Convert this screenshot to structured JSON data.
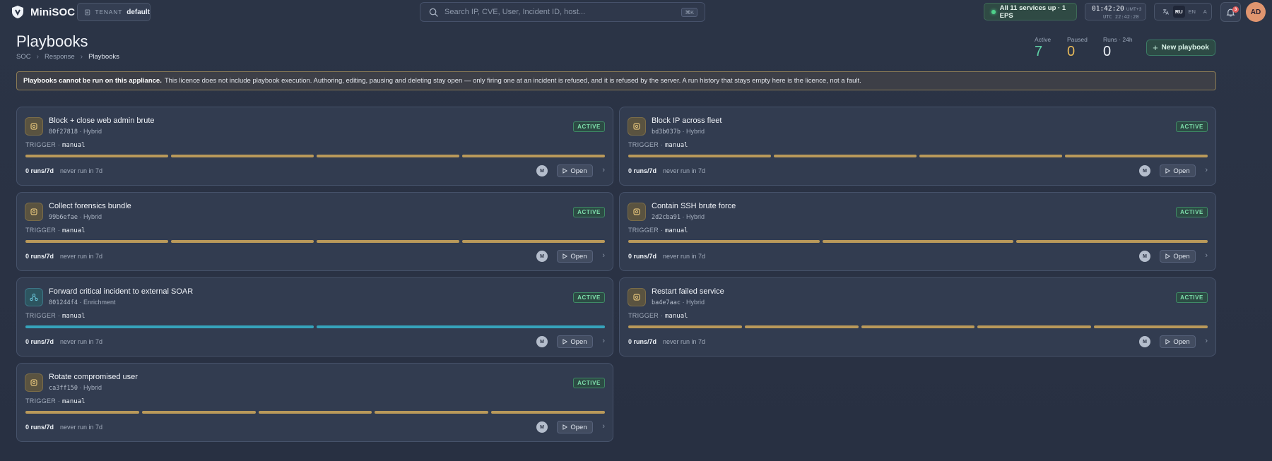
{
  "app": {
    "name": "MiniSOC",
    "tenant_label": "TENANT",
    "tenant_value": "default"
  },
  "search": {
    "placeholder": "Search IP, CVE, User, Incident ID, host...",
    "shortcut": "⌘K"
  },
  "status": {
    "services_text": "All 11 services up · 1 EPS",
    "status_color": "#4fd18b"
  },
  "clock": {
    "local_time": "01:42:20",
    "local_tz": "UMT+3",
    "utc_time": "UTC 22:42:20"
  },
  "language": {
    "options": [
      "RU",
      "EN",
      "A"
    ],
    "selected": "RU"
  },
  "notifications": {
    "count": "3"
  },
  "user": {
    "initials": "AD"
  },
  "page": {
    "title": "Playbooks",
    "breadcrumb": [
      "SOC",
      "Response",
      "Playbooks"
    ]
  },
  "stats": [
    {
      "label": "Active",
      "value": "7",
      "color": "#5fd3a8"
    },
    {
      "label": "Paused",
      "value": "0",
      "color": "#e6b95a"
    },
    {
      "label": "Runs · 24h",
      "value": "0",
      "color": "#eef2f8"
    }
  ],
  "actions": {
    "new_playbook": "New playbook"
  },
  "banner": {
    "title": "Playbooks cannot be run on this appliance.",
    "text": "This licence does not include playbook execution. Authoring, editing, pausing and deleting stay open — only firing one at an incident is refused, and it is refused by the server. A run history that stays empty here is the licence, not a fault."
  },
  "playbooks": [
    {
      "name": "Block + close web admin brute",
      "id": "80f27818",
      "kind": "Hybrid",
      "status": "ACTIVE",
      "trigger_label": "TRIGGER",
      "trigger": "manual",
      "steps": 4,
      "color": "gold",
      "icon": "gear-icon",
      "runs": "0 runs/7d",
      "last_run": "never run in 7d",
      "owner": "M",
      "open_label": "Open"
    },
    {
      "name": "Block IP across fleet",
      "id": "bd3b037b",
      "kind": "Hybrid",
      "status": "ACTIVE",
      "trigger_label": "TRIGGER",
      "trigger": "manual",
      "steps": 4,
      "color": "gold",
      "icon": "gear-icon",
      "runs": "0 runs/7d",
      "last_run": "never run in 7d",
      "owner": "M",
      "open_label": "Open"
    },
    {
      "name": "Collect forensics bundle",
      "id": "99b6efae",
      "kind": "Hybrid",
      "status": "ACTIVE",
      "trigger_label": "TRIGGER",
      "trigger": "manual",
      "steps": 4,
      "color": "gold",
      "icon": "gear-icon",
      "runs": "0 runs/7d",
      "last_run": "never run in 7d",
      "owner": "M",
      "open_label": "Open"
    },
    {
      "name": "Contain SSH brute force",
      "id": "2d2cba91",
      "kind": "Hybrid",
      "status": "ACTIVE",
      "trigger_label": "TRIGGER",
      "trigger": "manual",
      "steps": 3,
      "color": "gold",
      "icon": "gear-icon",
      "runs": "0 runs/7d",
      "last_run": "never run in 7d",
      "owner": "M",
      "open_label": "Open"
    },
    {
      "name": "Forward critical incident to external SOAR",
      "id": "801244f4",
      "kind": "Enrichment",
      "status": "ACTIVE",
      "trigger_label": "TRIGGER",
      "trigger": "manual",
      "steps": 2,
      "color": "teal",
      "icon": "network-icon",
      "runs": "0 runs/7d",
      "last_run": "never run in 7d",
      "owner": "M",
      "open_label": "Open"
    },
    {
      "name": "Restart failed service",
      "id": "ba4e7aac",
      "kind": "Hybrid",
      "status": "ACTIVE",
      "trigger_label": "TRIGGER",
      "trigger": "manual",
      "steps": 5,
      "color": "gold",
      "icon": "gear-icon",
      "runs": "0 runs/7d",
      "last_run": "never run in 7d",
      "owner": "M",
      "open_label": "Open"
    },
    {
      "name": "Rotate compromised user",
      "id": "ca3ff150",
      "kind": "Hybrid",
      "status": "ACTIVE",
      "trigger_label": "TRIGGER",
      "trigger": "manual",
      "steps": 5,
      "color": "gold",
      "icon": "gear-icon",
      "runs": "0 runs/7d",
      "last_run": "never run in 7d",
      "owner": "M",
      "open_label": "Open"
    }
  ]
}
